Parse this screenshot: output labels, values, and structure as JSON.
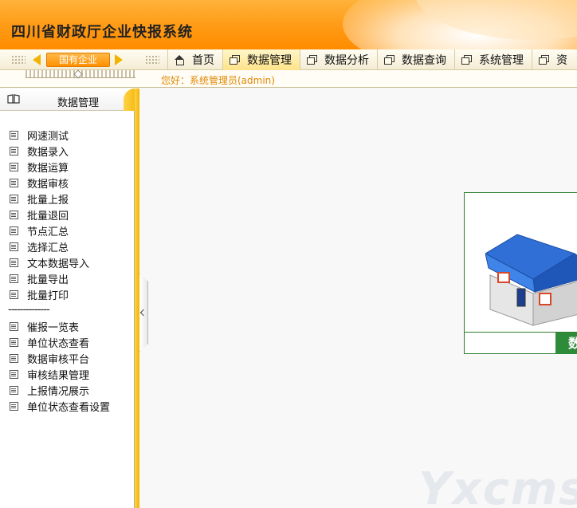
{
  "header": {
    "title": "四川省财政厅企业快报系统"
  },
  "navbar": {
    "region_selector": "国有企业",
    "tabs": [
      {
        "label": "首页",
        "icon": "home-icon",
        "active": false
      },
      {
        "label": "数据管理",
        "icon": "window-icon",
        "active": true
      },
      {
        "label": "数据分析",
        "icon": "window-icon",
        "active": false
      },
      {
        "label": "数据查询",
        "icon": "window-icon",
        "active": false
      },
      {
        "label": "系统管理",
        "icon": "window-icon",
        "active": false
      },
      {
        "label": "资",
        "icon": "window-icon",
        "active": false
      }
    ]
  },
  "subbar": {
    "greeting": "您好：系统管理员(admin)"
  },
  "sidebar": {
    "title": "数据管理",
    "items": [
      "网速测试",
      "数据录入",
      "数据运算",
      "数据审核",
      "批量上报",
      "批量退回",
      "节点汇总",
      "选择汇总",
      "文本数据导入",
      "批量导出",
      "批量打印"
    ],
    "separator": "--------------",
    "items2": [
      "催报一览表",
      "单位状态查看",
      "数据审核平台",
      "审核结果管理",
      "上报情况展示",
      "单位状态查看设置"
    ]
  },
  "main": {
    "card_button": "数",
    "watermark": "Yxcms"
  },
  "colors": {
    "accent": "#ff9a14",
    "greeting": "#e08700",
    "card_green": "#2e8b3a"
  }
}
